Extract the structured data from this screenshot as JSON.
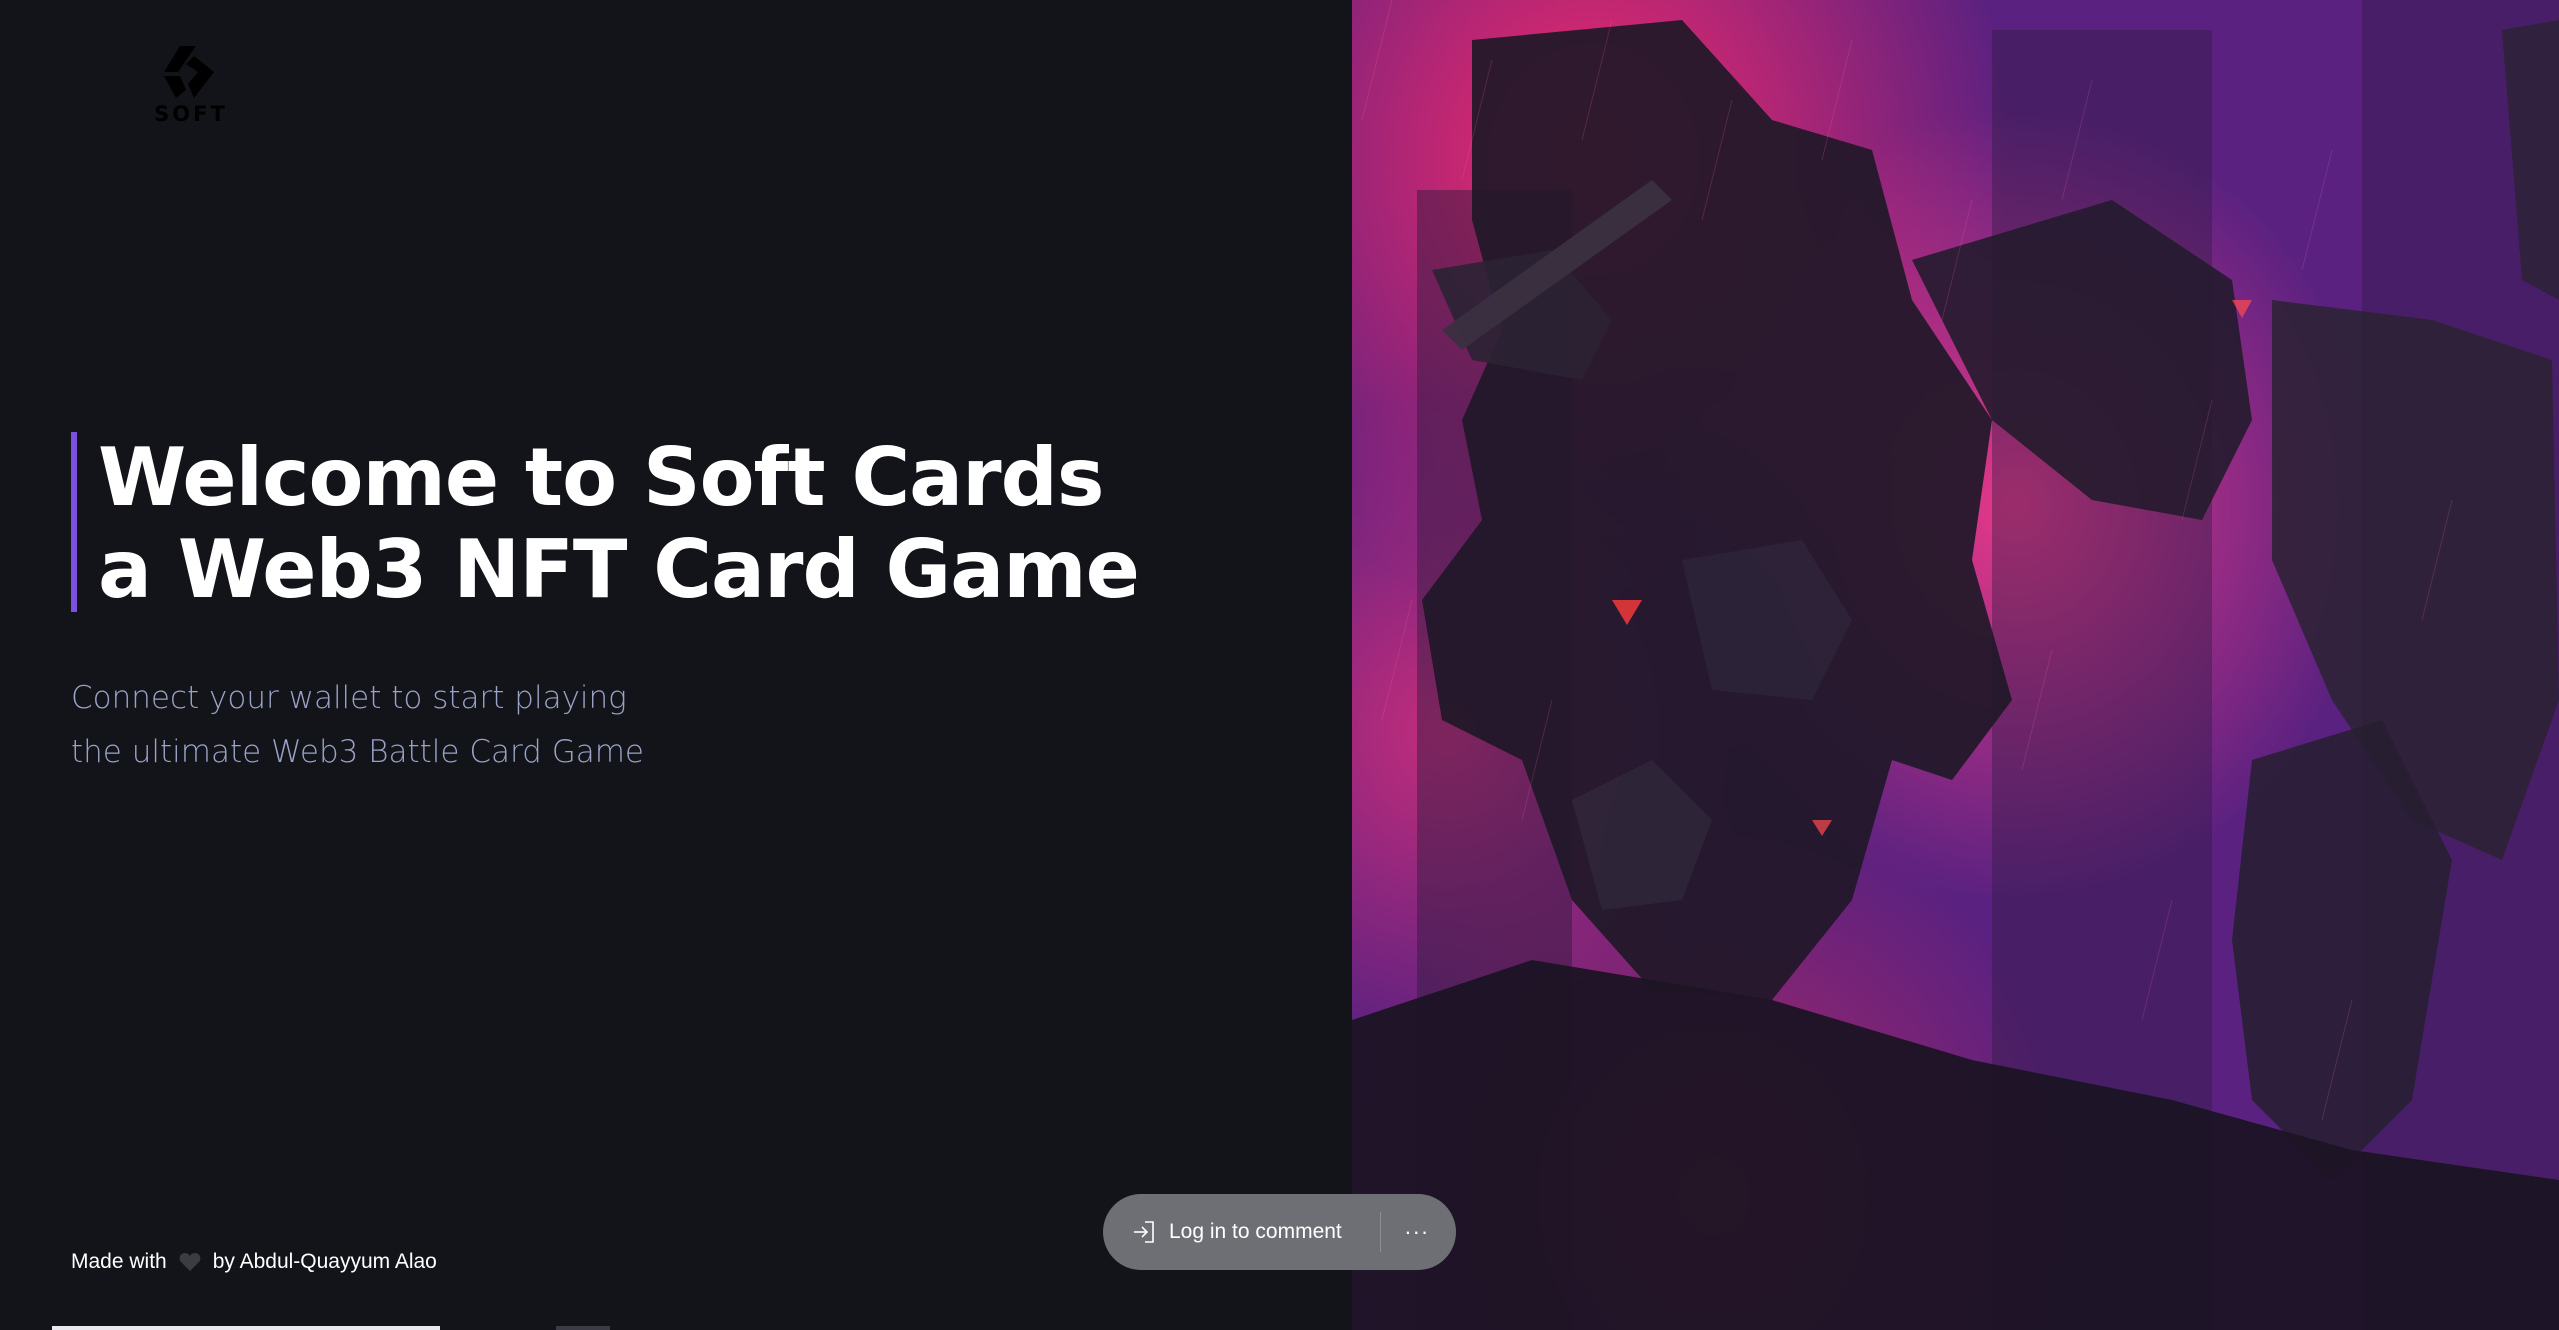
{
  "brand": {
    "logo_text": "SOFT"
  },
  "hero": {
    "headline_line1": "Welcome to Soft Cards",
    "headline_line2": "a Web3 NFT Card Game",
    "sub_line1": "Connect your wallet to start playing",
    "sub_line2": "the ultimate Web3 Battle Card Game",
    "accent_color": "#7b4fe0"
  },
  "footer": {
    "made_with": "Made with",
    "heart_icon": "heart-icon",
    "by_text": "by Abdul-Quayyum Alao"
  },
  "comment_widget": {
    "login_label": "Log in to comment",
    "login_icon": "sign-in-icon",
    "more_label": "···"
  },
  "colors": {
    "background": "#13141a",
    "headline": "#ffffff",
    "subtext": "#9aa3c7",
    "pill": "#6e6f75"
  }
}
